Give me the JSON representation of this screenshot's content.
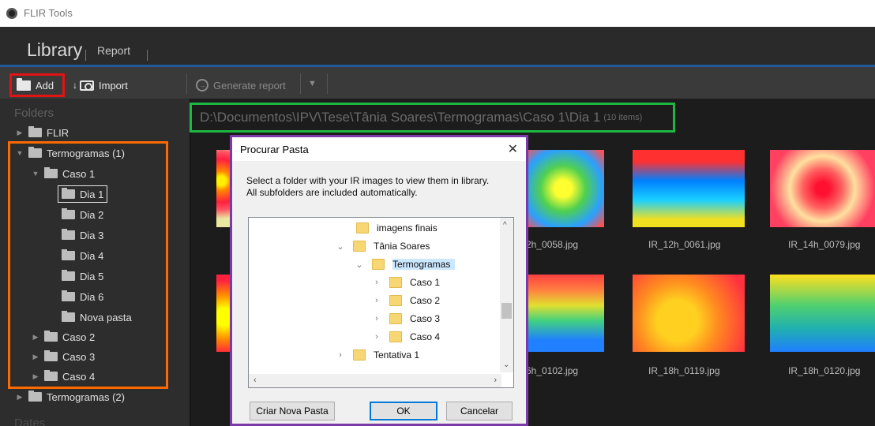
{
  "app": {
    "title": "FLIR Tools"
  },
  "nav": {
    "library": "Library",
    "report": "Report"
  },
  "toolbar": {
    "add": "Add",
    "import": "Import",
    "generate_report": "Generate report"
  },
  "sidebar": {
    "folders_heading": "Folders",
    "dates_heading": "Dates",
    "tree": [
      {
        "label": "FLIR"
      },
      {
        "label": "Termogramas (1)"
      },
      {
        "label": "Caso 1"
      },
      {
        "label": "Dia 1"
      },
      {
        "label": "Dia 2"
      },
      {
        "label": "Dia 3"
      },
      {
        "label": "Dia 4"
      },
      {
        "label": "Dia 5"
      },
      {
        "label": "Dia 6"
      },
      {
        "label": "Nova pasta"
      },
      {
        "label": "Caso 2"
      },
      {
        "label": "Caso 3"
      },
      {
        "label": "Caso 4"
      },
      {
        "label": "Termogramas (2)"
      }
    ]
  },
  "content": {
    "path": "D:\\Documentos\\IPV\\Tese\\Tânia Soares\\Termogramas\\Caso 1\\Dia 1",
    "count": "(10 items)",
    "thumbnails": [
      {
        "label": ""
      },
      {
        "label": "2h_0058.jpg"
      },
      {
        "label": "IR_12h_0061.jpg"
      },
      {
        "label": "IR_14h_0079.jpg"
      },
      {
        "label": ""
      },
      {
        "label": "6h_0102.jpg"
      },
      {
        "label": "IR_18h_0119.jpg"
      },
      {
        "label": "IR_18h_0120.jpg"
      }
    ]
  },
  "dialog": {
    "title": "Procurar Pasta",
    "message_line1": "Select a folder with your IR images to view them in library.",
    "message_line2": "All subfolders are included automatically.",
    "tree": [
      {
        "label": "imagens finais"
      },
      {
        "label": "Tânia Soares"
      },
      {
        "label": "Termogramas"
      },
      {
        "label": "Caso 1"
      },
      {
        "label": "Caso 2"
      },
      {
        "label": "Caso 3"
      },
      {
        "label": "Caso 4"
      },
      {
        "label": "Tentativa 1"
      }
    ],
    "buttons": {
      "new_folder": "Criar Nova Pasta",
      "ok": "OK",
      "cancel": "Cancelar"
    }
  },
  "colors": {
    "add_highlight": "#e31313",
    "sidebar_highlight": "#ff6a00",
    "path_highlight": "#1db742",
    "dialog_highlight": "#7a3aa8"
  }
}
